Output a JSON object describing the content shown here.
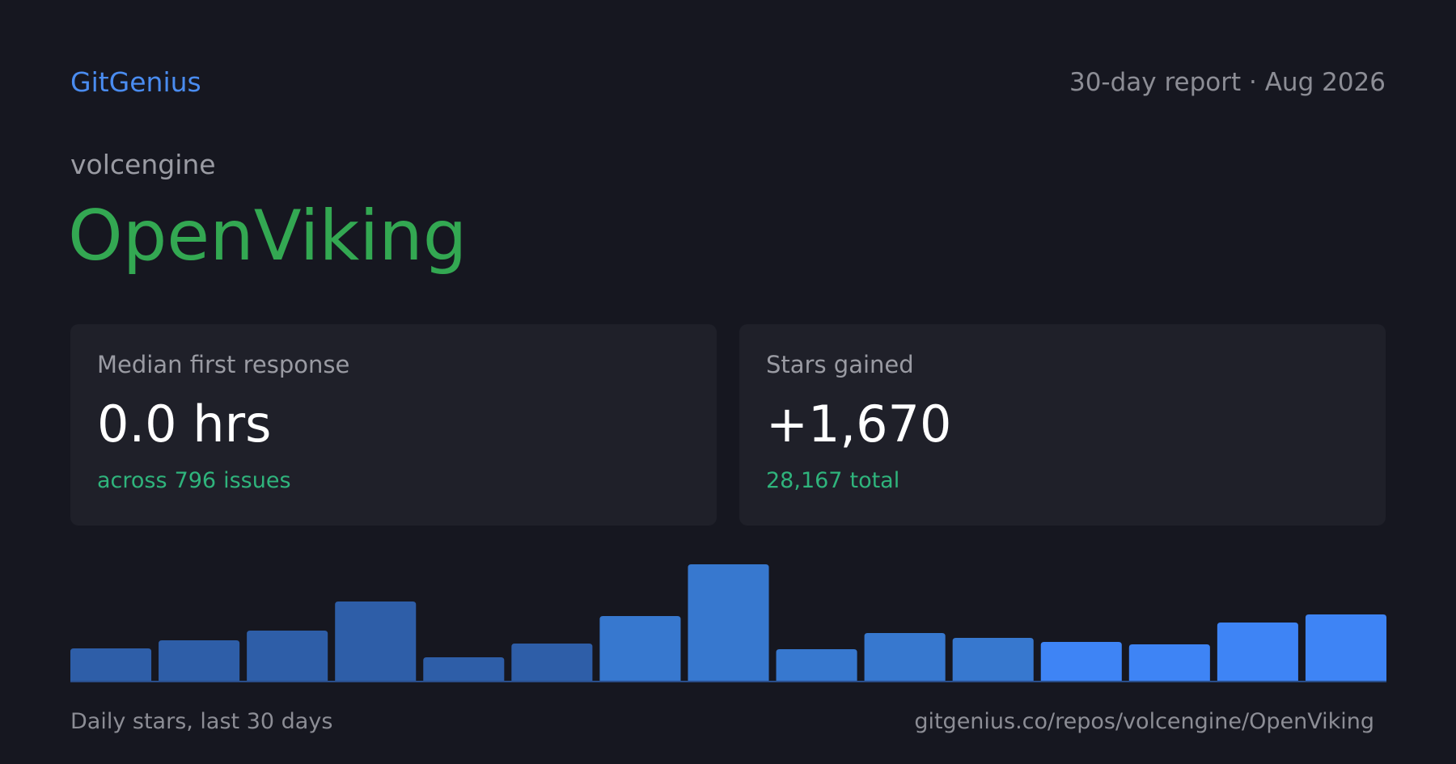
{
  "header": {
    "brand": "GitGenius",
    "report_label": "30-day report · Aug 2026"
  },
  "repo": {
    "owner": "volcengine",
    "name": "OpenViking"
  },
  "cards": {
    "response": {
      "label": "Median first response",
      "value": "0.0 hrs",
      "sub_prefix": "across",
      "sub_number": "796",
      "sub_suffix": "issues"
    },
    "stars": {
      "label": "Stars gained",
      "value": "+1,670",
      "sub_number": "28,167",
      "sub_suffix": "total"
    }
  },
  "colors": {
    "brand": "#4a8cf0",
    "repo_name": "#33a852",
    "accent_green": "#2fb47c",
    "bar_dark": "#2e5ea8",
    "bar_mid": "#3778cf",
    "bar_bright": "#3e84f5"
  },
  "footer": {
    "caption": "Daily stars, last 30 days",
    "url": "gitgenius.co/repos/volcengine/OpenViking"
  },
  "chart_data": {
    "type": "bar",
    "values": [
      40,
      50,
      62,
      98,
      29,
      46,
      80,
      144,
      39,
      59,
      53,
      48,
      45,
      72,
      82
    ],
    "bar_color_groups": [
      "dark",
      "dark",
      "dark",
      "dark",
      "dark",
      "dark",
      "mid",
      "mid",
      "mid",
      "mid",
      "mid",
      "bright",
      "bright",
      "bright",
      "bright"
    ],
    "ylim": [
      0,
      144
    ]
  }
}
